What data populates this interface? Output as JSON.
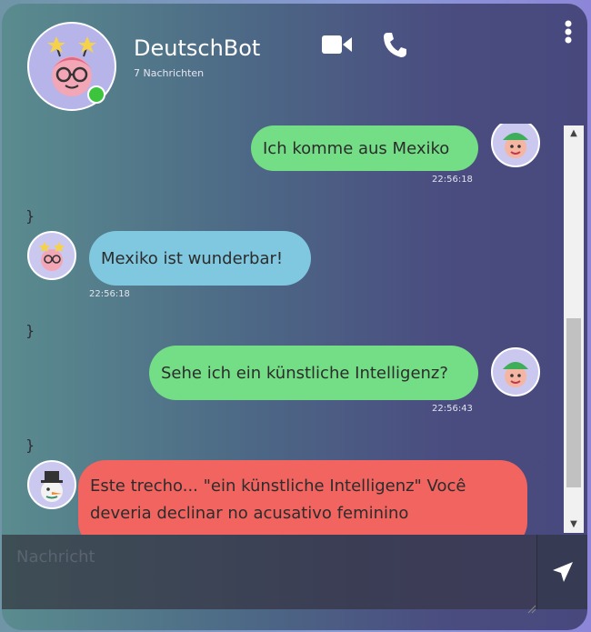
{
  "header": {
    "bot_name": "DeutschBot",
    "message_count": "7 Nachrichten",
    "online_color": "#3cc43c",
    "icons": [
      "video-camera-icon",
      "phone-icon",
      "kebab-menu-icon"
    ]
  },
  "messages": [
    {
      "sender": "user",
      "text": "Ich komme aus Mexiko",
      "time": "22:56:18"
    },
    {
      "sender": "bot",
      "text": "Mexiko ist wunderbar!",
      "time": "22:56:18"
    },
    {
      "sender": "user",
      "text": "Sehe ich ein künstliche Intelligenz?",
      "time": "22:56:43"
    },
    {
      "sender": "corrector",
      "text": "Este trecho... \"ein künstliche Intelligenz\" Você deveria declinar no acusativo feminino"
    }
  ],
  "stray_brace": "}",
  "input": {
    "placeholder": "Nachricht",
    "value": ""
  },
  "colors": {
    "sent_bubble": "#74de86",
    "received_bubble": "#7fc8e0",
    "correction_bubble": "#f1645f"
  }
}
